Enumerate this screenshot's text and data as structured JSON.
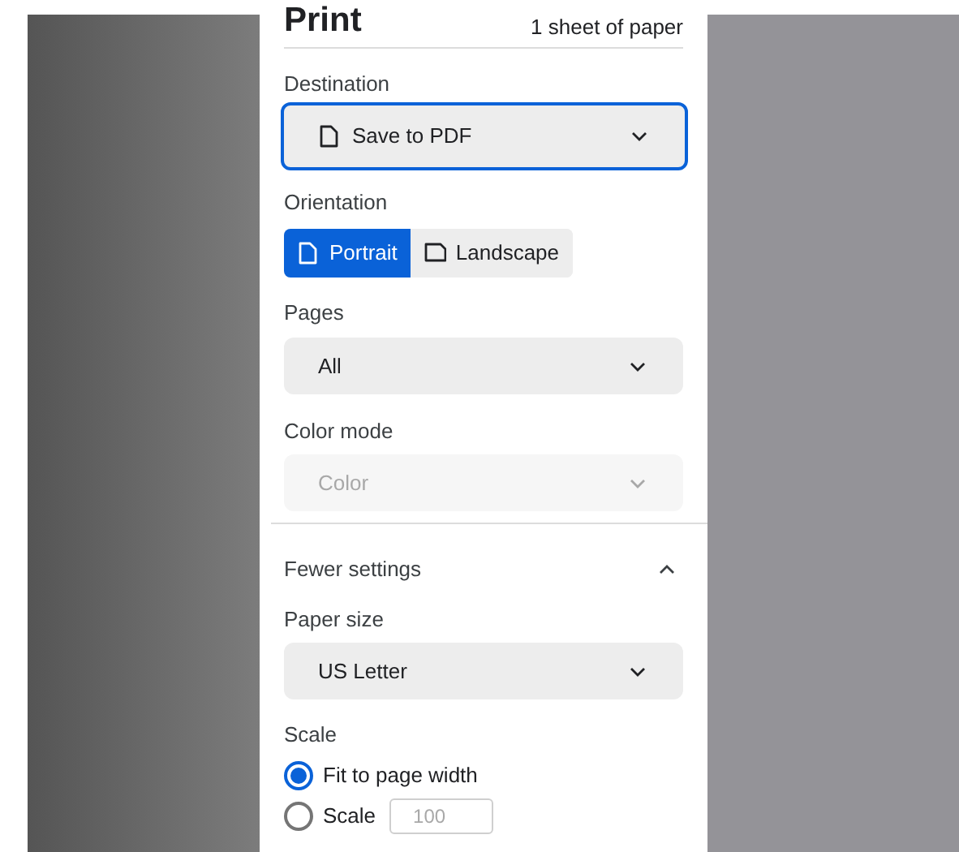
{
  "header": {
    "title": "Print",
    "sheet_count": "1 sheet of paper"
  },
  "destination": {
    "label": "Destination",
    "value": "Save to PDF",
    "focused": true
  },
  "orientation": {
    "label": "Orientation",
    "options": [
      {
        "label": "Portrait",
        "selected": true
      },
      {
        "label": "Landscape",
        "selected": false
      }
    ]
  },
  "pages": {
    "label": "Pages",
    "value": "All",
    "disabled": false
  },
  "color_mode": {
    "label": "Color mode",
    "value": "Color",
    "disabled": true
  },
  "more_settings": {
    "label": "Fewer settings",
    "expanded": true
  },
  "paper_size": {
    "label": "Paper size",
    "value": "US Letter",
    "disabled": false
  },
  "scale": {
    "label": "Scale",
    "options": [
      {
        "label": "Fit to page width",
        "selected": true
      },
      {
        "label": "Scale",
        "selected": false
      }
    ],
    "custom_value": "100"
  }
}
